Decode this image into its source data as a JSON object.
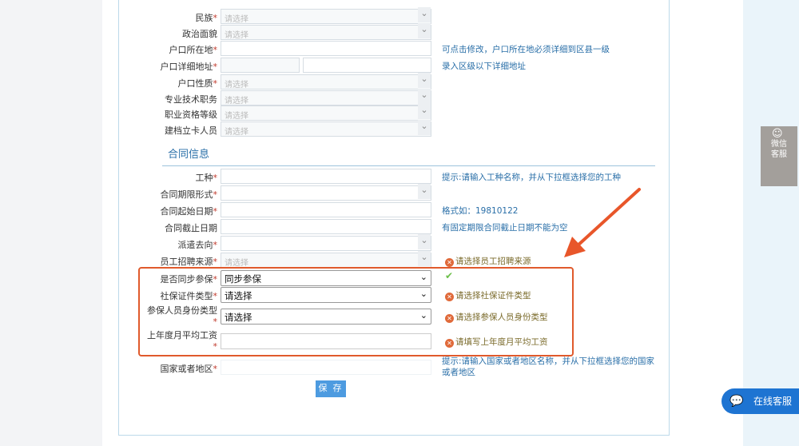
{
  "personal_rows": [
    {
      "label": "民族",
      "required": true,
      "type": "select",
      "placeholder": "请选择"
    },
    {
      "label": "政治面貌",
      "required": false,
      "type": "select",
      "placeholder": "请选择"
    },
    {
      "label": "户口所在地",
      "required": true,
      "type": "input",
      "value": "",
      "hint": "可点击修改，户口所在地必须详细到区县一级"
    },
    {
      "label": "户口详细地址",
      "required": true,
      "type": "double",
      "hint": "录入区级以下详细地址"
    },
    {
      "label": "户口性质",
      "required": true,
      "type": "select",
      "placeholder": "请选择"
    },
    {
      "label": "专业技术职务",
      "required": false,
      "type": "select",
      "placeholder": "请选择"
    },
    {
      "label": "职业资格等级",
      "required": false,
      "type": "select",
      "placeholder": "请选择"
    },
    {
      "label": "建档立卡人员",
      "required": false,
      "type": "select",
      "placeholder": "请选择"
    }
  ],
  "section_title": "合同信息",
  "contract_rows": [
    {
      "label": "工种",
      "required": true,
      "type": "input",
      "hint": "提示:请输入工种名称，并从下拉框选择您的工种"
    },
    {
      "label": "合同期限形式",
      "required": true,
      "type": "select",
      "placeholder": ""
    },
    {
      "label": "合同起始日期",
      "required": true,
      "type": "input",
      "hint": "格式如：19810122"
    },
    {
      "label": "合同截止日期",
      "required": false,
      "type": "input",
      "hint": "有固定期限合同截止日期不能为空"
    },
    {
      "label": "派遣去向",
      "required": true,
      "type": "select",
      "placeholder": ""
    },
    {
      "label": "员工招聘来源",
      "required": true,
      "type": "select",
      "placeholder": "请选择",
      "error": "请选择员工招聘来源"
    }
  ],
  "highlight_rows": [
    {
      "label": "是否同步参保",
      "value": "同步参保",
      "status": "ok"
    },
    {
      "label": "社保证件类型",
      "value": "请选择",
      "error": "请选择社保证件类型"
    },
    {
      "label": "参保人员身份类型",
      "value": "请选择",
      "error": "请选择参保人员身份类型"
    },
    {
      "label": "上年度月平均工资",
      "value": "",
      "error": "请填写上年度月平均工资"
    }
  ],
  "country": {
    "label": "国家或者地区",
    "hint_line1": "提示:请输入国家或者地区名称，并从下拉框选择您的国家",
    "hint_line2": "或者地区"
  },
  "save_label": "保 存",
  "required_mark": "*",
  "wechat": {
    "line1": "微信",
    "line2": "客服"
  },
  "online_service": "在线客服",
  "colors": {
    "highlight": "#e05a2c",
    "accent": "#2a6fa8",
    "button": "#4d9be0"
  }
}
